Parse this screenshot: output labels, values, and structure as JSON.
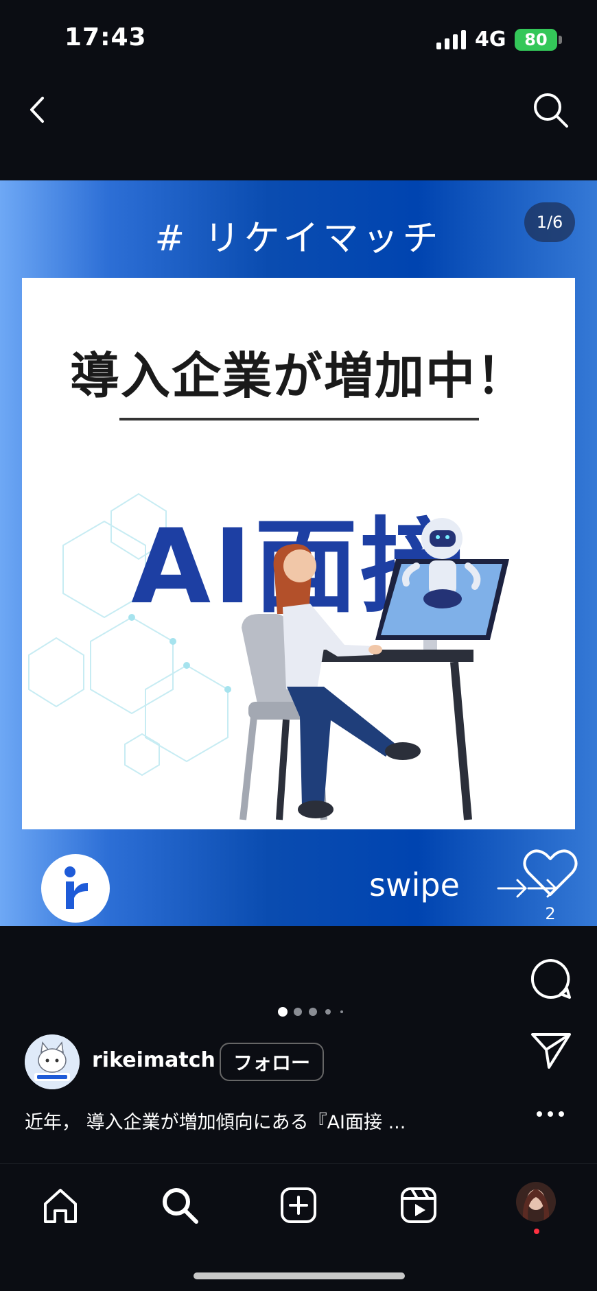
{
  "status": {
    "time": "17:43",
    "network": "4G",
    "battery": "80"
  },
  "post": {
    "hashtag": "# リケイマッチ",
    "counter": "1/6",
    "headline": "導入企業が増加中！",
    "big_title": "AI面接",
    "swipe": "swipe"
  },
  "actions": {
    "like_count": "2"
  },
  "carousel": {
    "total": 6,
    "active": 1
  },
  "user": {
    "name": "rikeimatch",
    "follow_label": "フォロー"
  },
  "caption": "近年， 導入企業が増加傾向にある『AI面接 ...",
  "colors": {
    "background": "#0b0d13",
    "brand_blue": "#1d3fa3",
    "battery_green": "#34c759",
    "notification": "#ff3040"
  },
  "icons": {
    "back": "chevron-left-icon",
    "search": "search-icon",
    "like": "heart-icon",
    "comment": "comment-icon",
    "share": "send-icon",
    "more": "more-icon",
    "home": "home-icon",
    "explore": "search-icon",
    "create": "plus-square-icon",
    "reels": "reels-icon"
  }
}
